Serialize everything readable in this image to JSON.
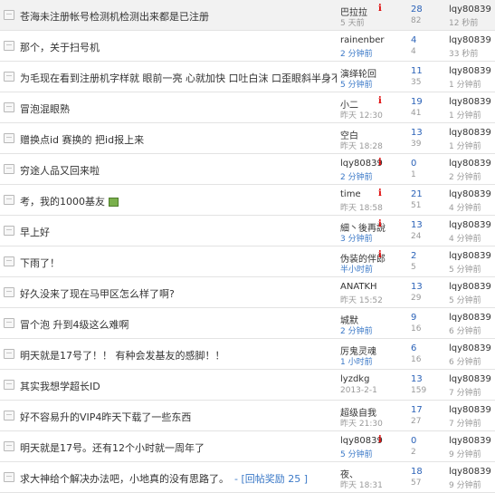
{
  "threads": [
    {
      "title": "苍海未注册帐号检测机检测出来都是已注册",
      "author": "巴拉拉",
      "author_time": "5 天前",
      "flag": "i",
      "replies": "28",
      "views": "82",
      "last_poster": "lqy80839",
      "last_time": "12 秒前",
      "highlight": true
    },
    {
      "title": "那个，关于扫号机",
      "author": "rainenber",
      "author_time": "2 分钟前",
      "flag": "",
      "replies": "4",
      "views": "4",
      "last_poster": "lqy80839",
      "last_time": "33 秒前",
      "highlight": false
    },
    {
      "title": "为毛现在看到注册机字样就  眼前一亮  心就加快  口吐白沫  口歪眼斜半身不遂",
      "author": "演绎轮回",
      "author_time": "5 分钟前",
      "flag": "",
      "replies": "11",
      "views": "35",
      "last_poster": "lqy80839",
      "last_time": "1 分钟前",
      "highlight": false
    },
    {
      "title": "冒泡混眼熟",
      "author": "小二",
      "author_time": "昨天 12:30",
      "flag": "i",
      "replies": "19",
      "views": "41",
      "last_poster": "lqy80839",
      "last_time": "1 分钟前",
      "highlight": false
    },
    {
      "title": "赠换点id 赛换的  把id报上来",
      "author": "空白",
      "author_time": "昨天 18:28",
      "flag": "",
      "replies": "13",
      "views": "39",
      "last_poster": "lqy80839",
      "last_time": "1 分钟前",
      "highlight": false
    },
    {
      "title": "穷途人品又回来啦",
      "author": "lqy80839",
      "author_time": "2 分钟前",
      "flag": "i",
      "replies": "0",
      "views": "1",
      "last_poster": "lqy80839",
      "last_time": "2 分钟前",
      "highlight": false
    },
    {
      "title": "考，我的1000基友",
      "author": "time",
      "author_time": "昨天 18:58",
      "flag": "i",
      "replies": "21",
      "views": "51",
      "last_poster": "lqy80839",
      "last_time": "4 分钟前",
      "highlight": false,
      "emoticon": true
    },
    {
      "title": "早上好",
      "author": "細丶後再說",
      "author_time": "3 分钟前",
      "flag": "i",
      "replies": "13",
      "views": "24",
      "last_poster": "lqy80839",
      "last_time": "4 分钟前",
      "highlight": false
    },
    {
      "title": "下雨了！",
      "author": "伪装的伴郎",
      "author_time": "半小时前",
      "flag": "i",
      "replies": "2",
      "views": "5",
      "last_poster": "lqy80839",
      "last_time": "5 分钟前",
      "highlight": false
    },
    {
      "title": "好久没来了现在马甲区怎么样了啊?",
      "author": "ANATKH",
      "author_time": "昨天 15:52",
      "flag": "",
      "replies": "13",
      "views": "29",
      "last_poster": "lqy80839",
      "last_time": "5 分钟前",
      "highlight": false
    },
    {
      "title": "冒个泡  升到4级这么难啊",
      "author": "城默",
      "author_time": "2 分钟前",
      "flag": "",
      "replies": "9",
      "views": "16",
      "last_poster": "lqy80839",
      "last_time": "6 分钟前",
      "highlight": false
    },
    {
      "title": "明天就是17号了！！ 有种会发基友的感脚！！",
      "author": "厉鬼灵魂",
      "author_time": "1 小时前",
      "flag": "",
      "replies": "6",
      "views": "16",
      "last_poster": "lqy80839",
      "last_time": "6 分钟前",
      "highlight": false
    },
    {
      "title": "其实我想学超长ID",
      "author": "lyzdkg",
      "author_time": "2013-2-1",
      "flag": "",
      "replies": "13",
      "views": "159",
      "last_poster": "lqy80839",
      "last_time": "7 分钟前",
      "highlight": false
    },
    {
      "title": "好不容易升的VIP4昨天下载了一些东西",
      "author": "超级自我",
      "author_time": "昨天 21:30",
      "flag": "",
      "replies": "17",
      "views": "27",
      "last_poster": "lqy80839",
      "last_time": "7 分钟前",
      "highlight": false
    },
    {
      "title": "明天就是17号。还有12个小时就一周年了",
      "author": "lqy80839",
      "author_time": "5 分钟前",
      "flag": "i",
      "replies": "0",
      "views": "2",
      "last_poster": "lqy80839",
      "last_time": "9 分钟前",
      "highlight": false
    },
    {
      "title": "求大神给个解决办法吧，小地真的没有思路了。",
      "bounty": "- [回帖奖励 25 ]",
      "author": "夜、",
      "author_time": "昨天 18:31",
      "flag": "",
      "replies": "18",
      "views": "57",
      "last_poster": "lqy80839",
      "last_time": "9 分钟前",
      "highlight": false
    }
  ],
  "colors": {
    "link_blue": "#2b62b8",
    "time_blue": "#3a78c7",
    "flag_red": "#dd0000",
    "highlight": "#f2f2f2"
  },
  "icons": {
    "thread": "folder-icon",
    "flag": "info-flag-icon",
    "emoticon": "smiley-icon"
  }
}
